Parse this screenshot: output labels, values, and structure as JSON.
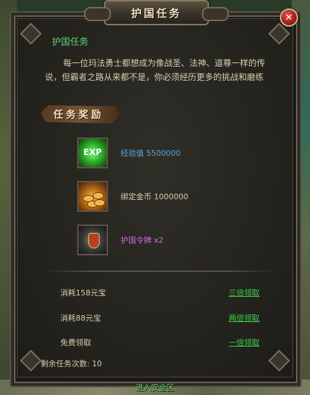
{
  "window": {
    "title": "护国任务"
  },
  "quest": {
    "name": "护国任务",
    "description": "每一位玛法勇士都想成为像战圣、法神、道尊一样的传说，但霸者之路从来都不是，你必须经历更多的挑战和磨练"
  },
  "rewards": {
    "banner": "任务奖励",
    "items": [
      {
        "icon": "exp-icon",
        "icon_text": "EXP",
        "name": "经验值",
        "amount": "5500000",
        "color": "#59a7e0"
      },
      {
        "icon": "gold-coins-icon",
        "name": "绑定金币",
        "amount": "1000000",
        "color": "#d8cfae"
      },
      {
        "icon": "token-icon",
        "name": "护国令牌",
        "amount": "x2",
        "color": "#d46ae8"
      }
    ]
  },
  "options": [
    {
      "cost": "消耗158元宝",
      "action": "三倍领取"
    },
    {
      "cost": "消耗88元宝",
      "action": "两倍领取"
    },
    {
      "cost": "免费领取",
      "action": "一倍领取"
    }
  ],
  "remaining": {
    "label": "剩余任务次数:",
    "value": "10"
  },
  "footer": {
    "enter_safe_zone": "进入安全区"
  },
  "colors": {
    "link": "#3fd04a",
    "quest_name": "#5fd37a",
    "body_text": "#d8cfae"
  }
}
